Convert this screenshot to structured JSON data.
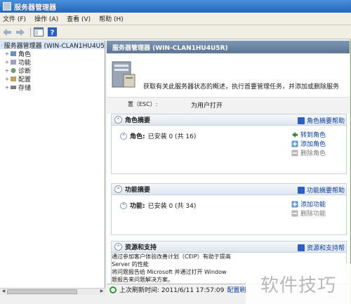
{
  "window": {
    "title": "服务器管理器"
  },
  "menu": [
    {
      "label": "文件 (F)"
    },
    {
      "label": "操作 (A)"
    },
    {
      "label": "查看 (V)"
    },
    {
      "label": "帮助 (H)"
    }
  ],
  "tree": {
    "root": "服务器管理器  (WIN-CLAN1HU4U5",
    "children": [
      {
        "label": "角色"
      },
      {
        "label": "功能"
      },
      {
        "label": "诊断"
      },
      {
        "label": "配置"
      },
      {
        "label": "存储"
      }
    ]
  },
  "main": {
    "header": "服务器管理器  (WIN-CLAN1HU4U5R)",
    "intro_text": "获取有关此服务器状态的概述，执行首要管理任务，并添加或删除服务",
    "esc_label": "置（ESC）:",
    "esc_text": "为用户打开"
  },
  "roles": {
    "title": "角色摘要",
    "help": "角色摘要帮助",
    "status_label": "角色:",
    "status_value": "已安装 0 (共 16)",
    "actions": [
      {
        "label": "转到角色",
        "enabled": true
      },
      {
        "label": "添加角色",
        "enabled": true
      },
      {
        "label": "删除角色",
        "enabled": false
      }
    ]
  },
  "features": {
    "title": "功能摘要",
    "help": "功能摘要帮助",
    "status_label": "功能:",
    "status_value": "已安装 0 (共 34)",
    "actions": [
      {
        "label": "添加功能",
        "enabled": true
      },
      {
        "label": "删除功能",
        "enabled": false
      }
    ]
  },
  "support": {
    "title": "资源和支持",
    "help": "资源和支持帮",
    "lines": [
      "通过参加客户体验改善计划（CEIP）有助于提高",
      "Server 的性能",
      "将问题报告给 Microsoft 并通过打开 Window",
      "题报告来问题解决方案。"
    ]
  },
  "statusbar": {
    "refresh_text": "上次刷新时间: 2011/6/11 17:57:09",
    "configure": "配置刷"
  },
  "watermark": "软件技巧"
}
